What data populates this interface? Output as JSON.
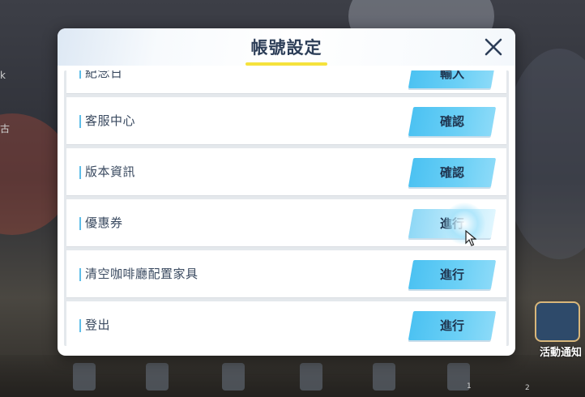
{
  "dialog": {
    "title": "帳號設定",
    "rows": [
      {
        "label": "紀念日",
        "button": "輸入",
        "partial": true
      },
      {
        "label": "客服中心",
        "button": "確認"
      },
      {
        "label": "版本資訊",
        "button": "確認"
      },
      {
        "label": "優惠券",
        "button": "進行",
        "highlighted": true
      },
      {
        "label": "清空咖啡廳配置家具",
        "button": "進行"
      },
      {
        "label": "登出",
        "button": "進行"
      }
    ]
  },
  "background": {
    "left_text_1": "k",
    "left_text_2": "古",
    "event_label": "活動通知",
    "badge_1": "1",
    "badge_2": "2"
  },
  "colors": {
    "accent_button": "#4cc2f2",
    "title_underline": "#f5e23c",
    "title_text": "#2d3e58"
  }
}
